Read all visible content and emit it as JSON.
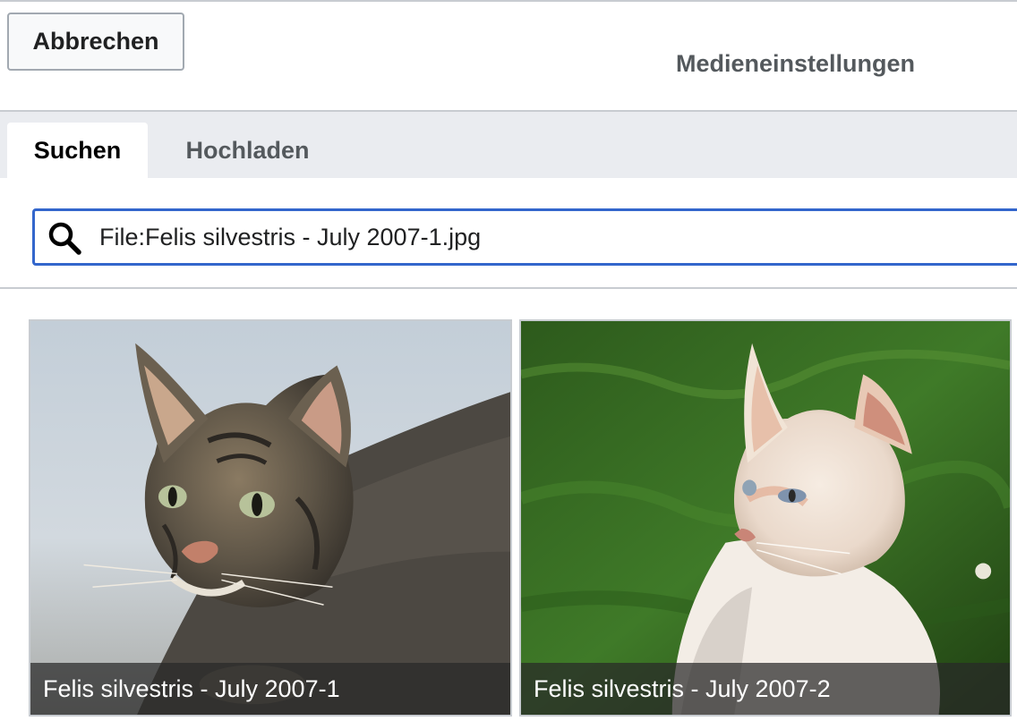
{
  "header": {
    "cancel_label": "Abbrechen",
    "title": "Medieneinstellungen"
  },
  "tabs": [
    {
      "label": "Suchen",
      "active": true
    },
    {
      "label": "Hochladen",
      "active": false
    }
  ],
  "search": {
    "value": "File:Felis silvestris - July 2007-1.jpg",
    "icon": "search-icon"
  },
  "results": [
    {
      "caption": "Felis silvestris - July 2007-1"
    },
    {
      "caption": "Felis silvestris - July 2007-2"
    }
  ],
  "colors": {
    "accent": "#3366cc",
    "tabbar_bg": "#eaecf0",
    "border": "#c8ccd1"
  }
}
